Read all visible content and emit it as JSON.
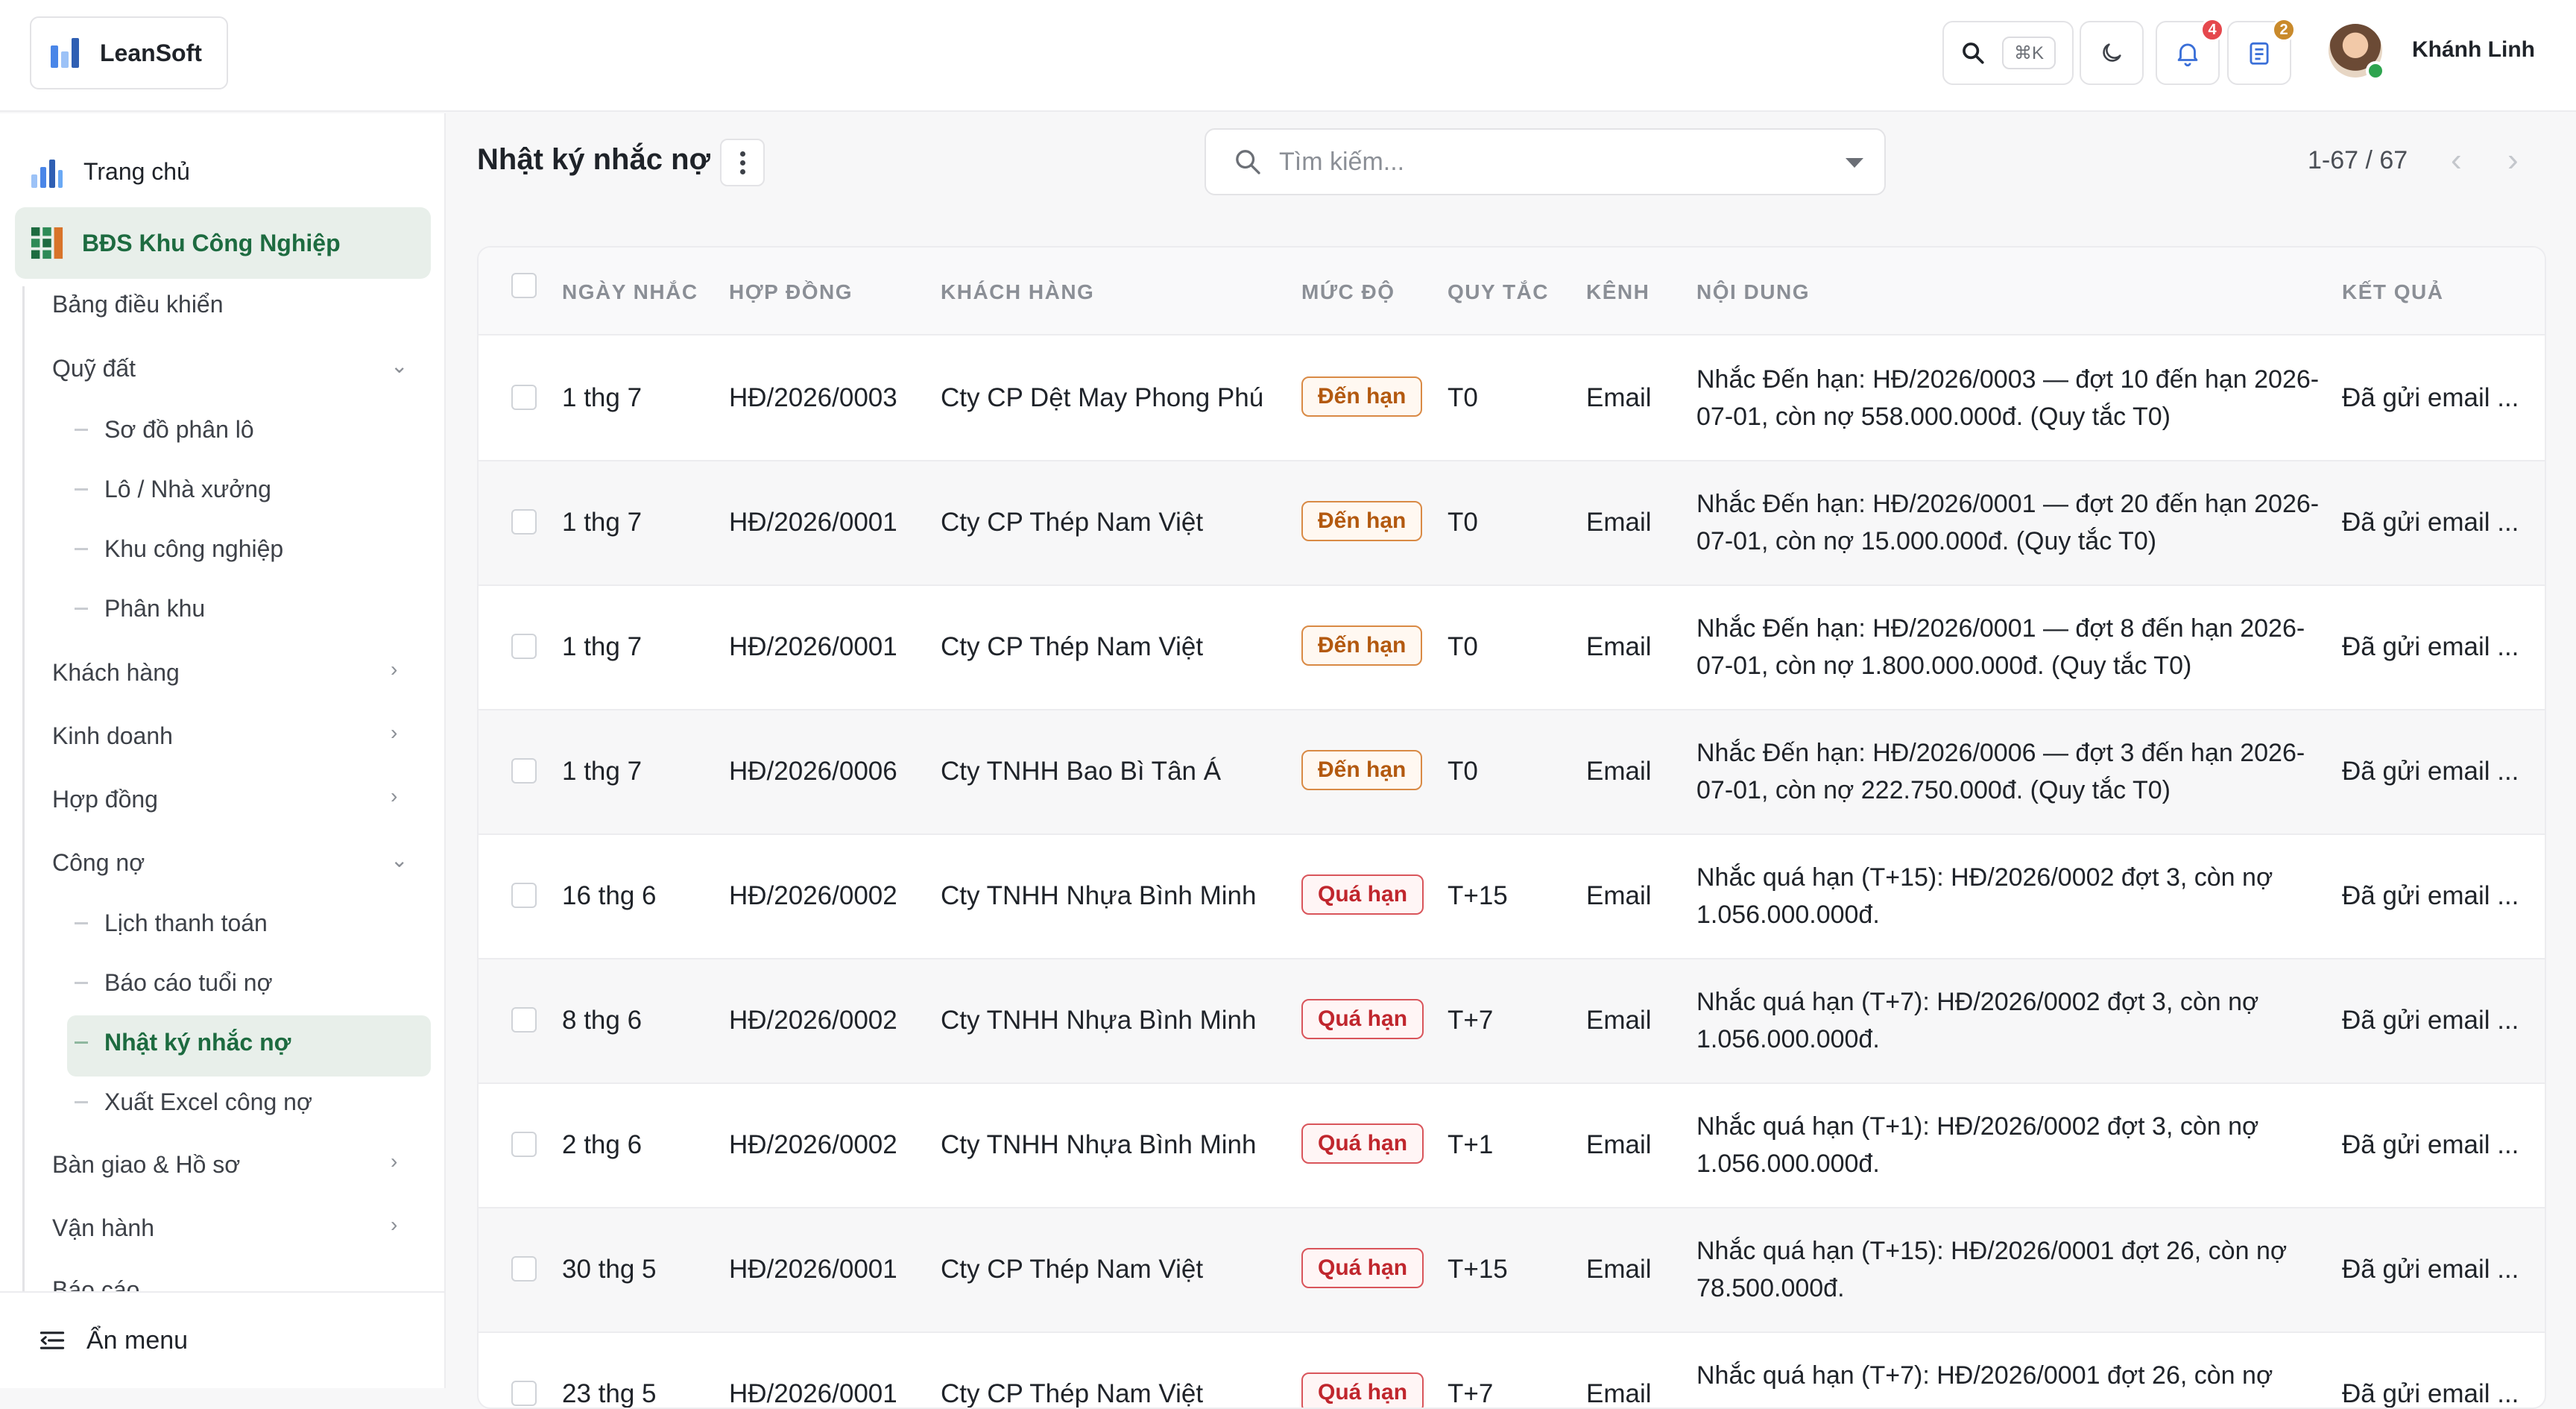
{
  "app": {
    "name": "LeanSoft",
    "logo_colors": [
      "#4a86e8",
      "#6aa9f5",
      "#2f5fb3"
    ]
  },
  "topbar": {
    "search_shortcut": "⌘K",
    "notification_count": "4",
    "task_count": "2",
    "user_name": "Khánh Linh",
    "badge_colors": {
      "notifications": "#e5484d",
      "tasks": "#c98a2b"
    }
  },
  "sidebar": {
    "home": "Trang chủ",
    "module": "BĐS Khu Công Nghiệp",
    "items": [
      {
        "label": "Bảng điều khiển"
      },
      {
        "label": "Quỹ đất",
        "expanded": true,
        "children": [
          "Sơ đồ phân lô",
          "Lô / Nhà xưởng",
          "Khu công nghiệp",
          "Phân khu"
        ]
      },
      {
        "label": "Khách hàng"
      },
      {
        "label": "Kinh doanh"
      },
      {
        "label": "Hợp đồng"
      },
      {
        "label": "Công nợ",
        "expanded": true,
        "children": [
          "Lịch thanh toán",
          "Báo cáo tuổi nợ",
          "Nhật ký nhắc nợ",
          "Xuất Excel công nợ"
        ]
      },
      {
        "label": "Bàn giao & Hồ sơ"
      },
      {
        "label": "Vận hành"
      },
      {
        "label": "Báo cáo"
      }
    ],
    "active_item": "Nhật ký nhắc nợ",
    "hide_menu": "Ẩn menu",
    "accent_color": "#1d6b40"
  },
  "page": {
    "title": "Nhật ký nhắc nợ",
    "search_placeholder": "Tìm kiếm...",
    "pagination": "1-67 / 67"
  },
  "table": {
    "columns": [
      "NGÀY NHẮC",
      "HỢP ĐỒNG",
      "KHÁCH HÀNG",
      "MỨC ĐỘ",
      "QUY TẮC",
      "KÊNH",
      "NỘI DUNG",
      "KẾT QUẢ"
    ],
    "rows": [
      {
        "date": "1 thg 7",
        "contract": "HĐ/2026/0003",
        "customer": "Cty CP Dệt May Phong Phú",
        "level": "Đến hạn",
        "rule": "T0",
        "channel": "Email",
        "content": "Nhắc Đến hạn: HĐ/2026/0003 — đợt 10 đến hạn 2026-07-01, còn nợ 558.000.000đ. (Quy tắc T0)",
        "result": "Đã gửi email ..."
      },
      {
        "date": "1 thg 7",
        "contract": "HĐ/2026/0001",
        "customer": "Cty CP Thép Nam Việt",
        "level": "Đến hạn",
        "rule": "T0",
        "channel": "Email",
        "content": "Nhắc Đến hạn: HĐ/2026/0001 — đợt 20 đến hạn 2026-07-01, còn nợ 15.000.000đ. (Quy tắc T0)",
        "result": "Đã gửi email ..."
      },
      {
        "date": "1 thg 7",
        "contract": "HĐ/2026/0001",
        "customer": "Cty CP Thép Nam Việt",
        "level": "Đến hạn",
        "rule": "T0",
        "channel": "Email",
        "content": "Nhắc Đến hạn: HĐ/2026/0001 — đợt 8 đến hạn 2026-07-01, còn nợ 1.800.000.000đ. (Quy tắc T0)",
        "result": "Đã gửi email ..."
      },
      {
        "date": "1 thg 7",
        "contract": "HĐ/2026/0006",
        "customer": "Cty TNHH Bao Bì Tân Á",
        "level": "Đến hạn",
        "rule": "T0",
        "channel": "Email",
        "content": "Nhắc Đến hạn: HĐ/2026/0006 — đợt 3 đến hạn 2026-07-01, còn nợ 222.750.000đ. (Quy tắc T0)",
        "result": "Đã gửi email ..."
      },
      {
        "date": "16 thg 6",
        "contract": "HĐ/2026/0002",
        "customer": "Cty TNHH Nhựa Bình Minh",
        "level": "Quá hạn",
        "rule": "T+15",
        "channel": "Email",
        "content": "Nhắc quá hạn (T+15): HĐ/2026/0002 đợt 3, còn nợ 1.056.000.000đ.",
        "result": "Đã gửi email ..."
      },
      {
        "date": "8 thg 6",
        "contract": "HĐ/2026/0002",
        "customer": "Cty TNHH Nhựa Bình Minh",
        "level": "Quá hạn",
        "rule": "T+7",
        "channel": "Email",
        "content": "Nhắc quá hạn (T+7): HĐ/2026/0002 đợt 3, còn nợ 1.056.000.000đ.",
        "result": "Đã gửi email ..."
      },
      {
        "date": "2 thg 6",
        "contract": "HĐ/2026/0002",
        "customer": "Cty TNHH Nhựa Bình Minh",
        "level": "Quá hạn",
        "rule": "T+1",
        "channel": "Email",
        "content": "Nhắc quá hạn (T+1): HĐ/2026/0002 đợt 3, còn nợ 1.056.000.000đ.",
        "result": "Đã gửi email ..."
      },
      {
        "date": "30 thg 5",
        "contract": "HĐ/2026/0001",
        "customer": "Cty CP Thép Nam Việt",
        "level": "Quá hạn",
        "rule": "T+15",
        "channel": "Email",
        "content": "Nhắc quá hạn (T+15): HĐ/2026/0001 đợt 26, còn nợ 78.500.000đ.",
        "result": "Đã gửi email ..."
      },
      {
        "date": "23 thg 5",
        "contract": "HĐ/2026/0001",
        "customer": "Cty CP Thép Nam Việt",
        "level": "Quá hạn",
        "rule": "T+7",
        "channel": "Email",
        "content": "Nhắc quá hạn (T+7): HĐ/2026/0001 đợt 26, còn nợ",
        "result": "Đã gửi email ..."
      }
    ],
    "level_colors": {
      "Đến hạn": {
        "text": "#b3590f",
        "border": "#d98a45",
        "bg": "#fff8f1"
      },
      "Quá hạn": {
        "text": "#c0262d",
        "border": "#d9555b",
        "bg": "#fff5f5"
      }
    }
  }
}
